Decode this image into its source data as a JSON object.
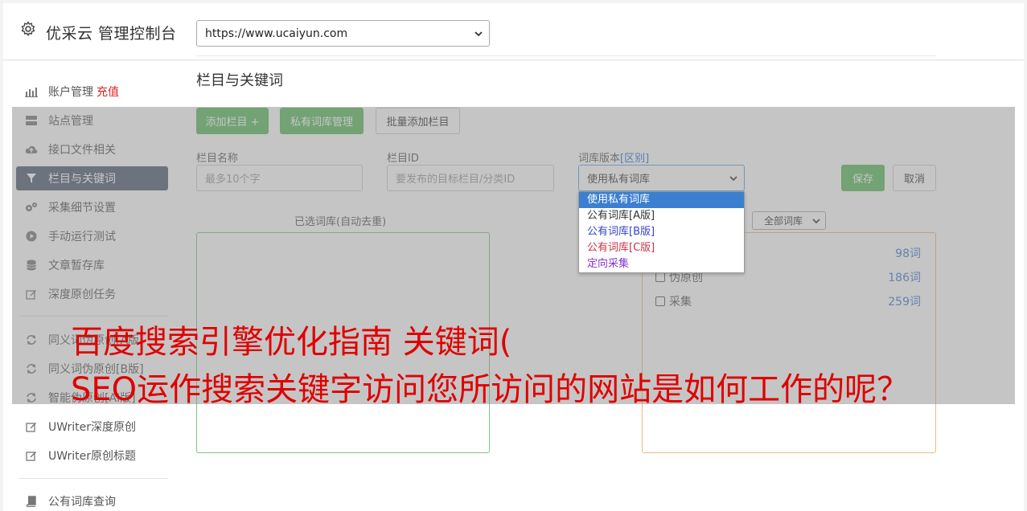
{
  "header": {
    "title": "优采云 管理控制台",
    "icon": "gear-icon"
  },
  "sidebar": {
    "items": [
      {
        "label": "账户管理",
        "badge": "充值",
        "icon": "bar-chart-icon"
      },
      {
        "label": "站点管理",
        "icon": "server-icon"
      },
      {
        "label": "接口文件相关",
        "icon": "cloud-upload-icon"
      },
      {
        "label": "栏目与关键词",
        "icon": "filter-icon",
        "active": true
      },
      {
        "label": "采集细节设置",
        "icon": "cogs-icon"
      },
      {
        "label": "手动运行测试",
        "icon": "play-circle-icon"
      },
      {
        "label": "文章暂存库",
        "icon": "database-icon"
      },
      {
        "label": "深度原创任务",
        "icon": "edit-icon"
      },
      {
        "label": "同义词伪原创[A版]",
        "icon": "refresh-icon"
      },
      {
        "label": "同义词伪原创[B版]",
        "icon": "refresh-icon"
      },
      {
        "label": "智能伪原创[AI版]",
        "icon": "refresh-icon"
      },
      {
        "label": "UWriter深度原创",
        "icon": "edit-icon"
      },
      {
        "label": "UWriter原创标题",
        "icon": "edit-icon"
      },
      {
        "label": "公有词库查询",
        "icon": "book-icon"
      }
    ]
  },
  "main": {
    "site_select": "https://www.ucaiyun.com",
    "section_title": "栏目与关键词",
    "buttons": {
      "add_column": "添加栏目 +",
      "private_lib": "私有词库管理",
      "batch_add": "批量添加栏目"
    },
    "form": {
      "column_name_label": "栏目名称",
      "column_name_placeholder": "最多10个字",
      "column_id_label": "栏目ID",
      "column_id_placeholder": "要发布的目标栏目/分类ID",
      "lib_version_label": "词库版本",
      "lib_version_link": "[区别]",
      "lib_version_value": "使用私有词库",
      "save": "保存",
      "cancel": "取消"
    },
    "dropdown_options": [
      {
        "label": "使用私有词库",
        "color": "#ffffff",
        "highlighted": true
      },
      {
        "label": "公有词库[A版]",
        "color": "#333333"
      },
      {
        "label": "公有词库[B版]",
        "color": "#3344cc"
      },
      {
        "label": "公有词库[C版]",
        "color": "#cc3344"
      },
      {
        "label": "定向采集",
        "color": "#8833cc"
      }
    ],
    "selected_libs_title": "已选词库(自动去重)",
    "lib_filter": "全部词库",
    "lib_rows": [
      {
        "label": "",
        "count": "98词"
      },
      {
        "label": "伪原创",
        "count": "186词"
      },
      {
        "label": "采集",
        "count": "259词"
      }
    ]
  },
  "overlay": {
    "line1": "百度搜索引擎优化指南 关键词(",
    "line2": "SEO运作搜索关键字访问您所访问的网站是如何工作的呢？"
  }
}
